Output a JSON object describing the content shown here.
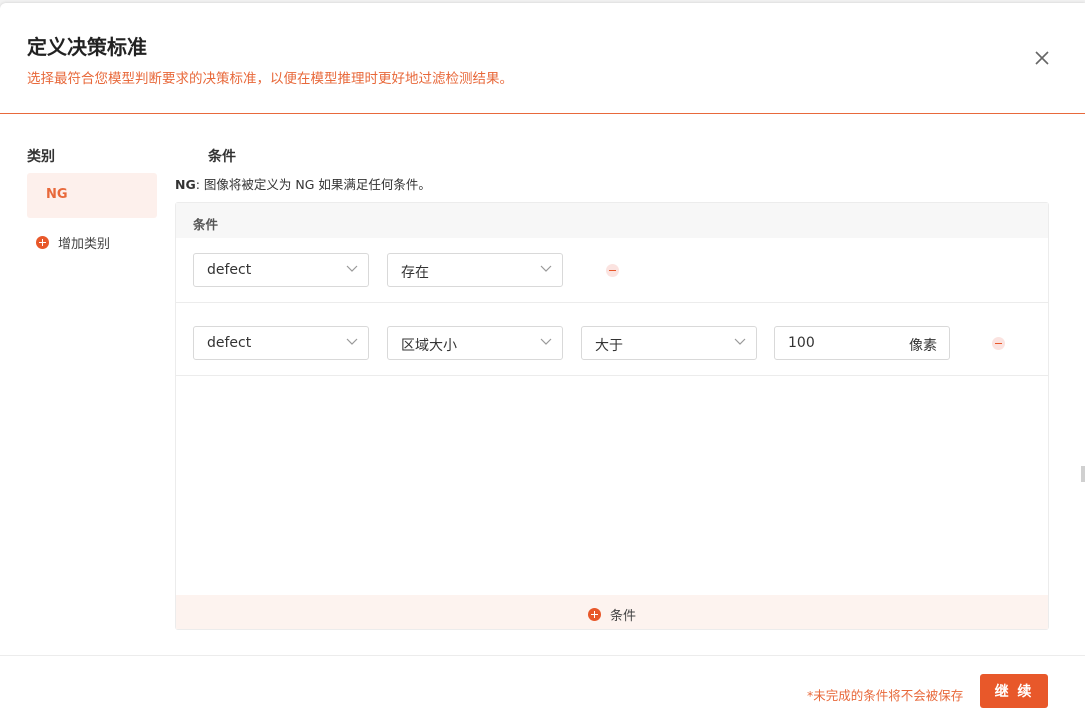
{
  "background": {
    "text": ""
  },
  "dialog": {
    "title": "定义决策标准",
    "subtitle": "选择最符合您模型判断要求的决策标准，以便在模型推理时更好地过滤检测结果。",
    "close_icon": "close-icon"
  },
  "categories": {
    "header": "类别",
    "items": [
      {
        "label": "NG"
      }
    ],
    "add_label": "增加类别"
  },
  "conditions": {
    "header": "条件",
    "description_prefix": "NG",
    "description_text": ": 图像将被定义为 NG 如果满足任何条件。",
    "table_header": "条件",
    "rows": [
      {
        "class_select": "defect",
        "metric_select": "存在"
      },
      {
        "class_select": "defect",
        "metric_select": "区域大小",
        "operator_select": "大于",
        "value": "100",
        "unit": "像素"
      }
    ],
    "add_label": "条件"
  },
  "footer": {
    "note": "*未完成的条件将不会被保存",
    "continue_label": "继 续"
  },
  "colors": {
    "accent": "#e8582a",
    "subtitle": "#e8693b",
    "selected_bg": "#fdf0ec"
  }
}
